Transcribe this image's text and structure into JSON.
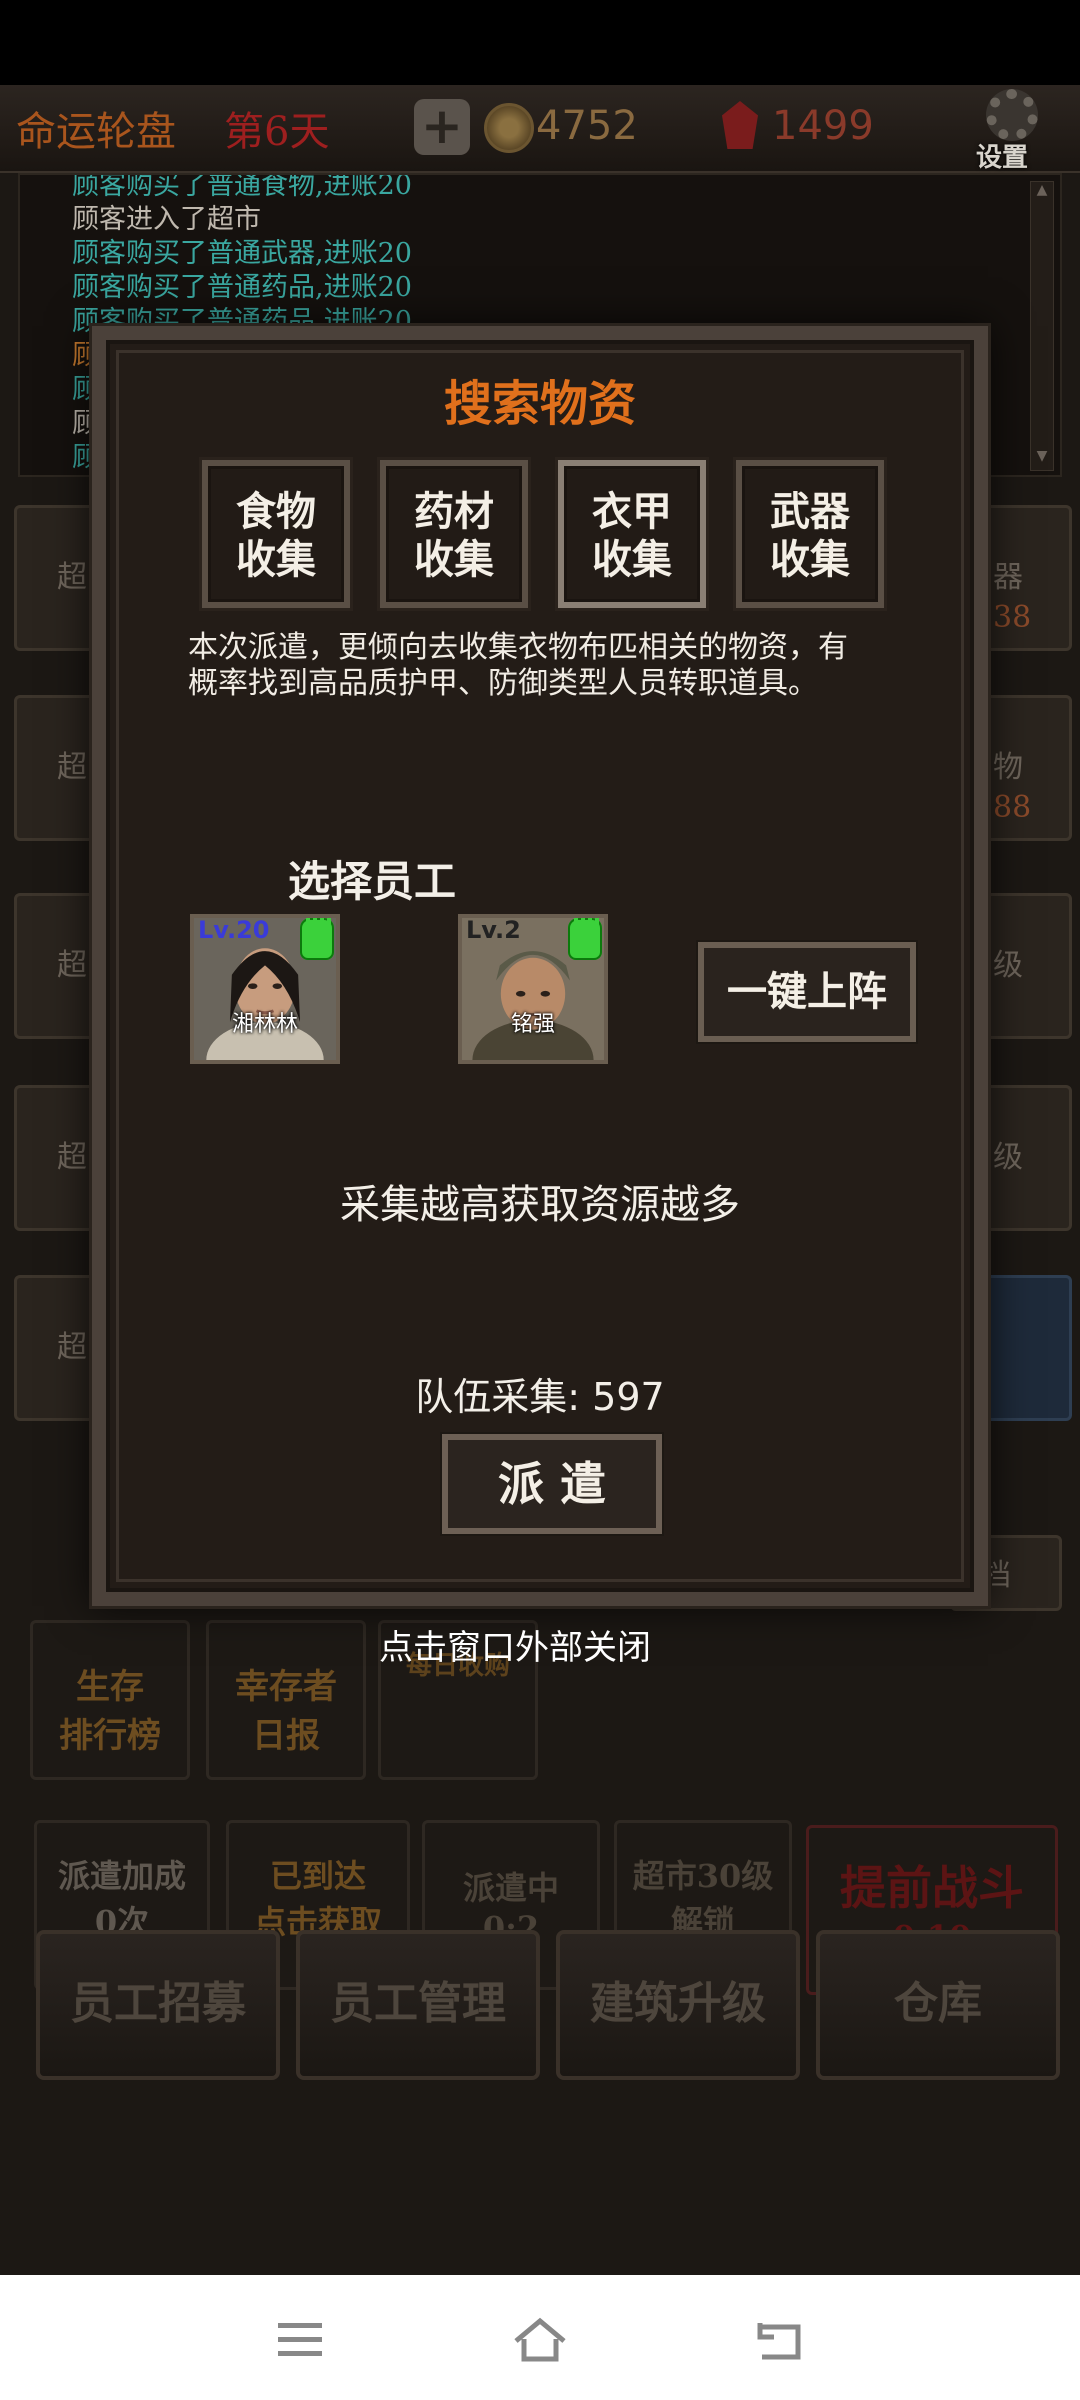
{
  "topbar": {
    "title": "命运轮盘",
    "day": "第6天",
    "coins": "4752",
    "gems": "1499",
    "settings_label": "设置"
  },
  "log": [
    {
      "text": "顾客购买了普通食物,进账20",
      "color": "#3aa7a0"
    },
    {
      "text": "顾客进入了超市",
      "color": "#bfb8ae"
    },
    {
      "text": "顾客购买了普通武器,进账20",
      "color": "#3aa7a0"
    },
    {
      "text": "顾客购买了普通药品,进账20",
      "color": "#3aa7a0"
    },
    {
      "text": "顾客购买了普通药品,进账20",
      "color": "#3aa7a0"
    },
    {
      "text": "顾",
      "color": "#c77a2e"
    },
    {
      "text": "顾",
      "color": "#3aa7a0"
    },
    {
      "text": "顾",
      "color": "#bfb8ae"
    },
    {
      "text": "顾",
      "color": "#3aa7a0"
    }
  ],
  "background_panels": {
    "left_label": "超",
    "right_labels": [
      "器",
      "物",
      "级",
      "级"
    ],
    "right_numbers": [
      "38",
      "88"
    ],
    "archive_label": "档"
  },
  "bottom_tiles": {
    "ranking": "生存\n排行榜",
    "daily": "幸存者\n日报",
    "daily_income": "每日收购",
    "dispatch_bonus_line1": "派遣加成",
    "dispatch_bonus_line2": "0次",
    "arrived_line1": "已到达",
    "arrived_line2": "点击获取",
    "dispatching_line1": "派遣中",
    "dispatching_line2": "0:2",
    "unlock_line1": "超市30级",
    "unlock_line2": "解锁",
    "fight_line1": "提前战斗",
    "fight_line2": "0:10"
  },
  "bottom_buttons": [
    "员工招募",
    "员工管理",
    "建筑升级",
    "仓库"
  ],
  "modal": {
    "title": "搜索物资",
    "categories": [
      {
        "line1": "食物",
        "line2": "收集",
        "selected": false
      },
      {
        "line1": "药材",
        "line2": "收集",
        "selected": false
      },
      {
        "line1": "衣甲",
        "line2": "收集",
        "selected": true
      },
      {
        "line1": "武器",
        "line2": "收集",
        "selected": false
      }
    ],
    "description": "本次派遣，更倾向去收集衣物布匹相关的物资，有概率找到高品质护甲、防御类型人员转职道具。",
    "select_label": "选择员工",
    "employees": [
      {
        "level": "Lv.20",
        "name": "湘林林",
        "level_color": "#3a3bd8"
      },
      {
        "level": "Lv.2",
        "name": "铭强",
        "level_color": "#222222"
      }
    ],
    "onekey_label": "一键上阵",
    "hint": "采集越高获取资源越多",
    "team_stat": "队伍采集: 597",
    "dispatch_label": "派 遣"
  },
  "close_tip": "点击窗口外部关闭",
  "navbar": {
    "icons": [
      "menu-icon",
      "home-icon",
      "back-icon"
    ]
  }
}
